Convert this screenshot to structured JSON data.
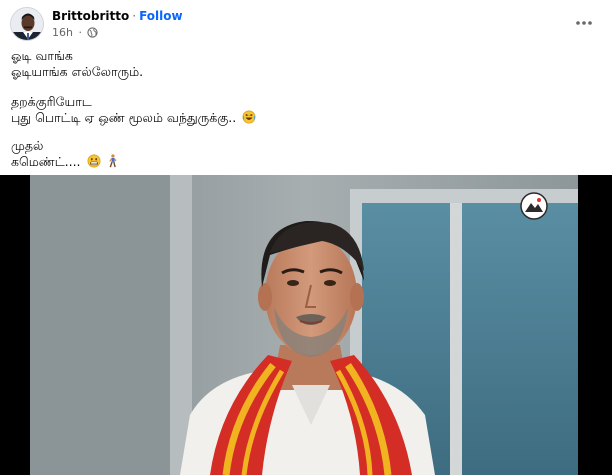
{
  "post": {
    "author": "Brittobritto",
    "separator": "·",
    "follow_label": "Follow",
    "time": "16h",
    "time_separator": "·",
    "privacy_icon": "globe-icon",
    "menu_icon": "more-horizontal-icon",
    "text": {
      "line1": "ஓடி வாங்க",
      "line2": "ஓடியாங்க எல்லோரும்.",
      "line3": "தறக்குரியோட",
      "line4": "புது பொட்டி ஏ ஒண் மூலம் வந்துருக்கு..",
      "line5": "முதல்",
      "line6": "கமெண்ட்....",
      "emoji_laugh": "laughing-emoji",
      "emoji_grin": "grimacing-emoji",
      "emoji_walk": "person-walking-emoji"
    }
  },
  "media": {
    "type": "video-thumbnail",
    "channel_logo": "channel-logo-icon",
    "colors": {
      "wall": "#9aa3a6",
      "door": "#4f7f93",
      "scarf_red": "#d42d26",
      "scarf_yellow": "#f1b320",
      "shirt": "#f3f3f1"
    }
  },
  "colors": {
    "follow": "#0866ff",
    "secondary_text": "#65676b",
    "text": "#050505"
  }
}
